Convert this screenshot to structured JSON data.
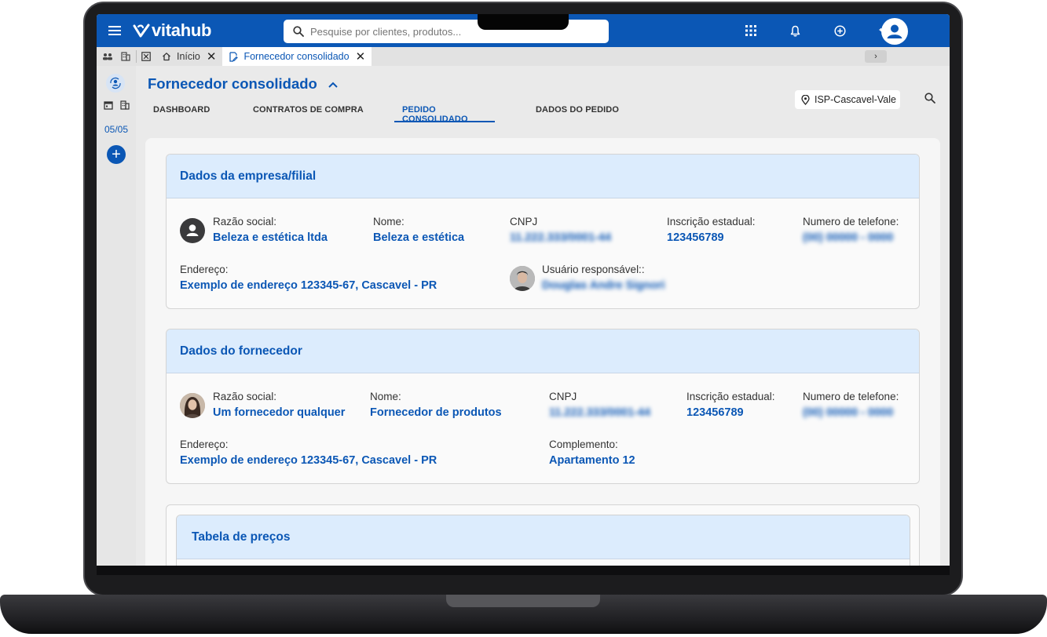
{
  "topbar": {
    "logo_text": "vitahub",
    "search_placeholder": "Pesquise por clientes, produtos..."
  },
  "tabs": [
    {
      "label": "Início"
    },
    {
      "label": "Fornecedor consolidado"
    }
  ],
  "rail": {
    "date": "05/05"
  },
  "page": {
    "title": "Fornecedor consolidado",
    "nav_tabs": [
      "DASHBOARD",
      "CONTRATOS DE COMPRA",
      "PEDIDO CONSOLIDADO",
      "DADOS DO PEDIDO"
    ],
    "active_tab": "PEDIDO CONSOLIDADO",
    "location": "ISP-Cascavel-Vale"
  },
  "empresa": {
    "section_title": "Dados da empresa/filial",
    "razao_label": "Razão social:",
    "razao_value": "Beleza e estética ltda",
    "nome_label": "Nome:",
    "nome_value": "Beleza e estética",
    "cnpj_label": "CNPJ",
    "cnpj_value": "11.222.333/0001-44",
    "ie_label": "Inscrição estadual:",
    "ie_value": "123456789",
    "tel_label": "Numero de telefone:",
    "tel_value": "(00) 00000 - 0000",
    "endereco_label": "Endereço:",
    "endereco_value": "Exemplo de endereço 123345-67, Cascavel - PR",
    "usuario_label": "Usuário responsável::",
    "usuario_value": "Douglas Andre Signori"
  },
  "fornecedor": {
    "section_title": "Dados do fornecedor",
    "razao_label": "Razão social:",
    "razao_value": "Um fornecedor qualquer",
    "nome_label": "Nome:",
    "nome_value": "Fornecedor de produtos",
    "cnpj_label": "CNPJ",
    "cnpj_value": "11.222.333/0001-44",
    "ie_label": "Inscrição estadual:",
    "ie_value": "123456789",
    "tel_label": "Numero de telefone:",
    "tel_value": "(00) 00000 - 0000",
    "endereco_label": "Endereço:",
    "endereco_value": "Exemplo de endereço 123345-67, Cascavel - PR",
    "complemento_label": "Complemento:",
    "complemento_value": "Apartamento 12"
  },
  "precos": {
    "section_title": "Tabela de preços"
  },
  "colors": {
    "brand": "#0b57b5",
    "section_header_bg": "#dcecfd"
  }
}
